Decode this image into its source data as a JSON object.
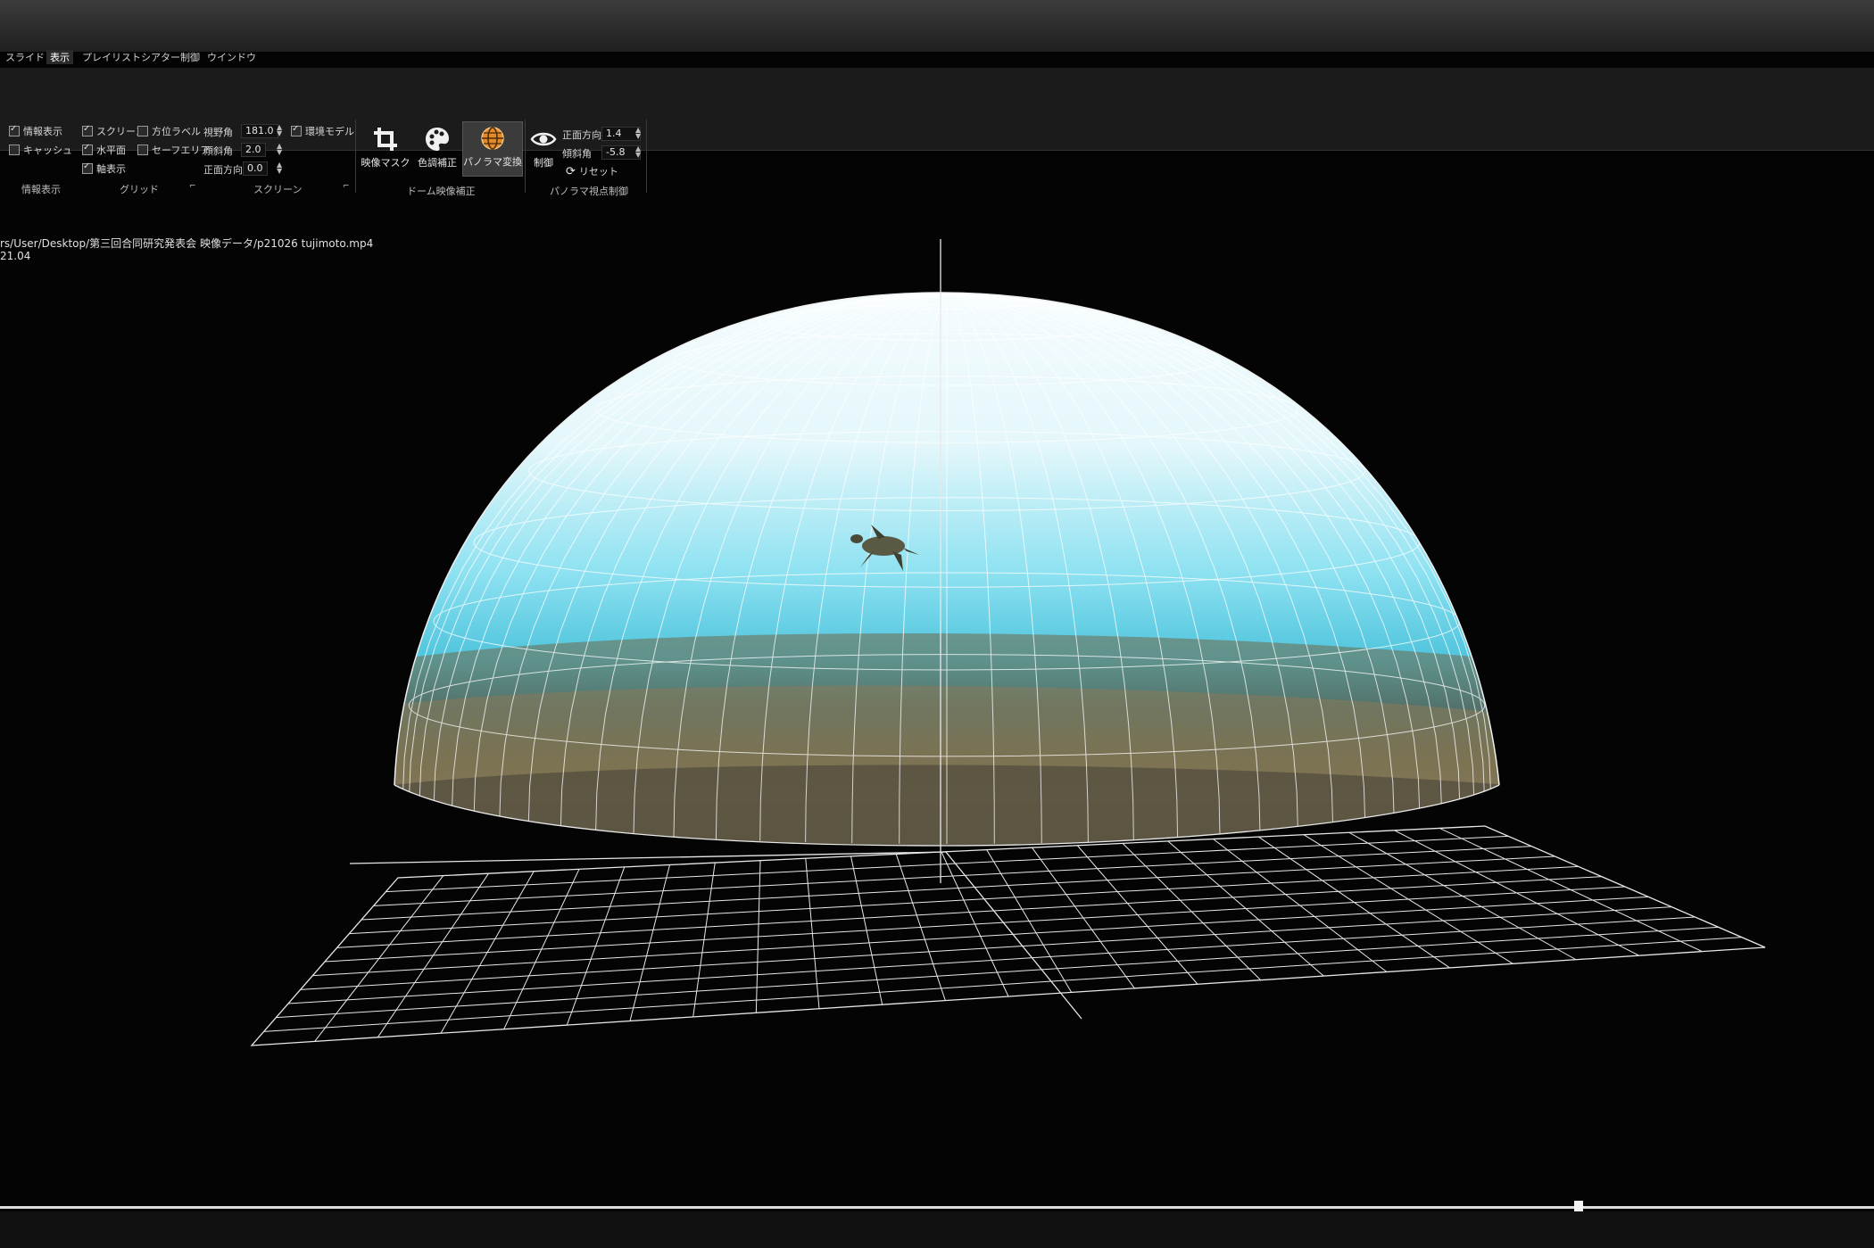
{
  "menu_tabs": [
    "スライド",
    "表示",
    "プレイリスト",
    "シアター制御",
    "ウインドウ"
  ],
  "active_tab": "表示",
  "info_group": {
    "items": [
      {
        "label": "情報表示",
        "checked": true
      },
      {
        "label": "キャッシュ",
        "checked": false
      }
    ],
    "title": "情報表示"
  },
  "grid_group": {
    "items": [
      {
        "label": "スクリーン",
        "checked": true
      },
      {
        "label": "方位ラベル",
        "checked": false
      },
      {
        "label": "水平面",
        "checked": true
      },
      {
        "label": "セーフエリア",
        "checked": false
      },
      {
        "label": "軸表示",
        "checked": true
      }
    ],
    "title": "グリッド"
  },
  "screen_group": {
    "fov_label": "視野角",
    "fov_value": "181.0",
    "tilt_label": "傾斜角",
    "tilt_value": "2.0",
    "front_label": "正面方向",
    "front_value": "0.0",
    "env_model_label": "環境モデル",
    "env_model_checked": true,
    "title": "スクリーン"
  },
  "dome_group": {
    "buttons": [
      {
        "label": "映像マスク",
        "icon": "crop-icon"
      },
      {
        "label": "色調補正",
        "icon": "palette-icon"
      },
      {
        "label": "パノラマ変換",
        "icon": "globe-icon"
      }
    ],
    "title": "ドーム映像補正"
  },
  "panorama_group": {
    "control_label": "制御",
    "front_label": "正面方向",
    "front_value": "1.4",
    "tilt_label": "傾斜角",
    "tilt_value": "-5.8",
    "reset_label": "リセット",
    "title": "パノラマ視点制御"
  },
  "file_path": "rs/User/Desktop/第三回合同研究発表会 映像データ/p21026 tujimoto.mp4",
  "timecode": "21.04",
  "colors": {
    "ribbon_bg": "#1b1b1b",
    "sky_top": "#f4fbfd",
    "sky_mid": "#6fd6ea",
    "sea_floor": "#7b6b52",
    "grid_line": "#e8e8e8"
  },
  "playback": {
    "progress": 0.84
  }
}
